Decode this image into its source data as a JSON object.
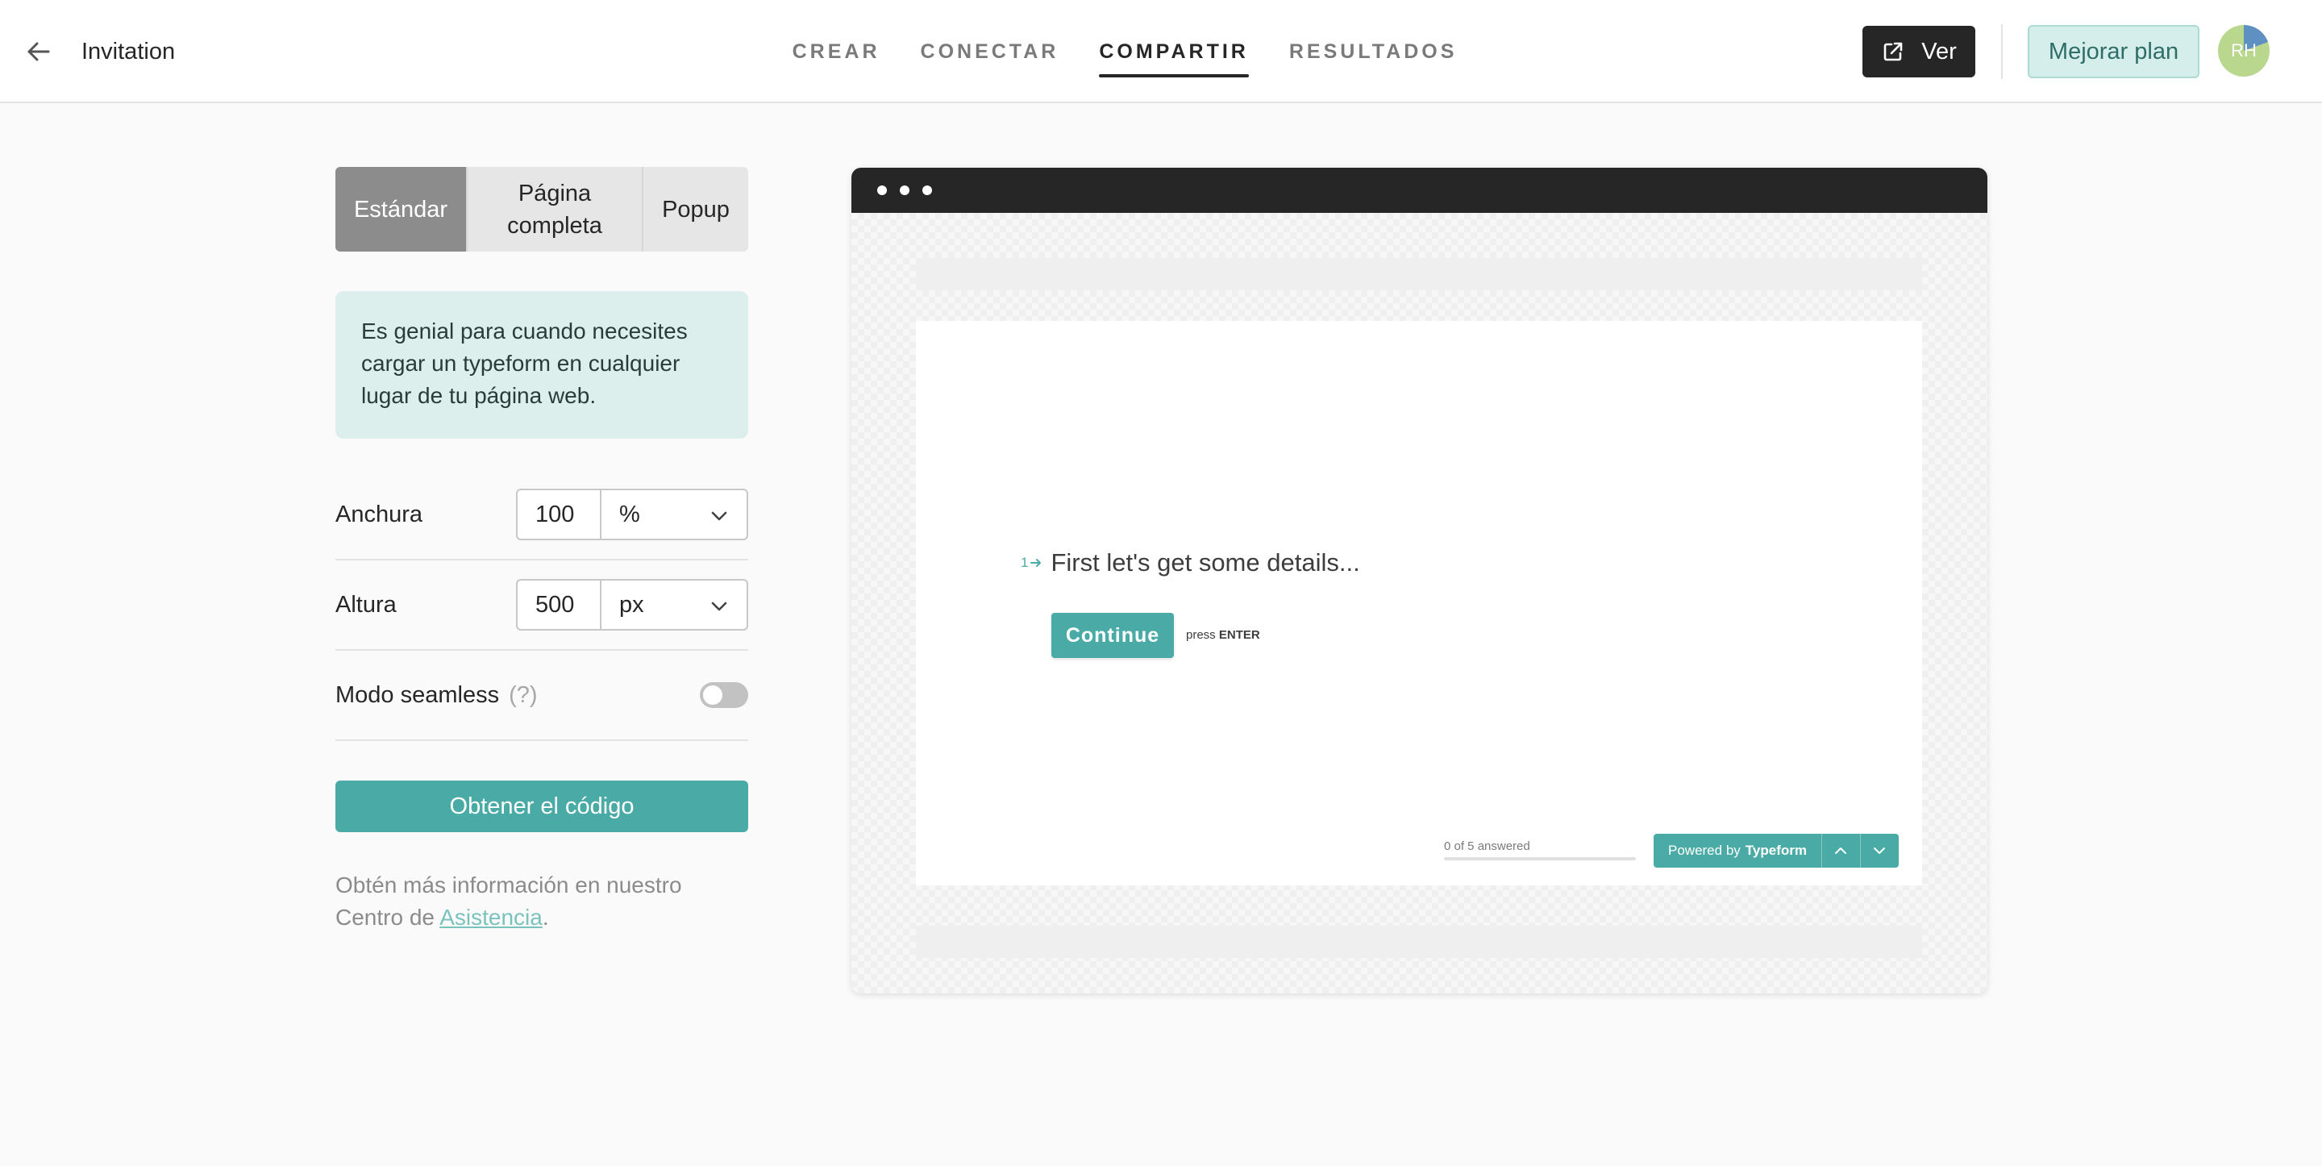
{
  "header": {
    "form_title": "Invitation",
    "tabs": [
      {
        "label": "CREAR",
        "active": false
      },
      {
        "label": "CONECTAR",
        "active": false
      },
      {
        "label": "COMPARTIR",
        "active": true
      },
      {
        "label": "RESULTADOS",
        "active": false
      }
    ],
    "view_label": "Ver",
    "upgrade_label": "Mejorar plan",
    "avatar_initials": "RH"
  },
  "embed_options": {
    "modes": [
      {
        "label": "Estándar",
        "active": true
      },
      {
        "label": "Página completa",
        "active": false
      },
      {
        "label": "Popup",
        "active": false
      }
    ],
    "description": "Es genial para cuando necesites cargar un typeform en cualquier lugar de tu página web.",
    "width": {
      "label": "Anchura",
      "value": "100",
      "unit": "%"
    },
    "height": {
      "label": "Altura",
      "value": "500",
      "unit": "px"
    },
    "seamless": {
      "label": "Modo seamless",
      "help": "(?)",
      "enabled": false
    },
    "get_code_label": "Obtener el código",
    "help_prefix": "Obtén más información en nuestro Centro de ",
    "help_link": "Asistencia",
    "help_suffix": "."
  },
  "preview": {
    "question_number": "1",
    "question_text": "First let's get some details...",
    "continue_label": "Continue",
    "press_label": "press",
    "enter_label": "ENTER",
    "progress_text": "0 of 5 answered",
    "progress_fraction": 0,
    "powered_prefix": "Powered by",
    "powered_brand": "Typeform"
  },
  "colors": {
    "accent": "#4aaba6",
    "header_dark": "#262627",
    "info_bg": "#dcefed",
    "upgrade_bg": "#d6eeeb"
  },
  "icons": [
    "arrow-left-icon",
    "external-link-icon",
    "chevron-down-icon",
    "arrow-right-icon",
    "chevron-up-icon"
  ]
}
